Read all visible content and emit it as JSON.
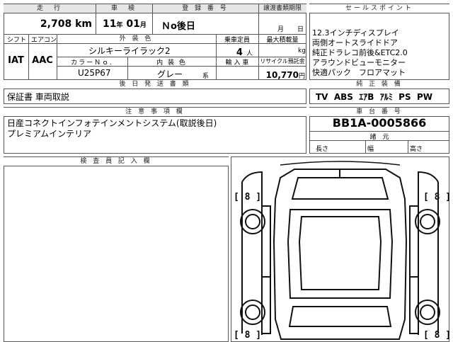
{
  "top_fields": {
    "mileage_header": "走　行",
    "mileage_value": "2,708",
    "mileage_unit": "km",
    "inspection_header": "車　検",
    "inspection_year": "11",
    "inspection_year_unit": "年",
    "inspection_month": "01",
    "inspection_month_unit": "月",
    "registration_header": "登 録 番 号",
    "registration_value": "Ｎo後日",
    "transfer_deadline_header": "譲渡書類期限",
    "transfer_deadline_month": "月",
    "transfer_deadline_day": "日"
  },
  "second_row": {
    "shift_header": "シフト",
    "shift_value": "IAT",
    "aircon_header": "エアコン",
    "aircon_value": "AAC",
    "exterior_color_header": "外 装 色",
    "exterior_color_value": "シルキーライラック2",
    "capacity_header": "乗車定員",
    "capacity_value": "4",
    "capacity_unit": "人",
    "max_load_header": "最大積載量",
    "max_load_unit": "kg",
    "color_no_header": "カラーＮｏ.",
    "color_no_value": "U25P67",
    "interior_color_header": "内 装 色",
    "interior_color_value": "グレー",
    "interior_color_suffix": "系",
    "import_header": "輸 入 車",
    "recycle_header": "リサイクル預託金",
    "recycle_value": "10,770",
    "recycle_unit": "円"
  },
  "later_docs": {
    "header": "後 日 発 送 書 類",
    "value": "保証書 車両取説"
  },
  "sales_points": {
    "header": "セールスポイント",
    "items": [
      "12.3インチディスプレイ",
      "両側オートスライドドア",
      "純正ドラレコ前後&ETC2.0",
      "アラウンドビューモニター",
      "快適パック　フロアマット"
    ]
  },
  "equipment": {
    "header": "純 正 装 備",
    "items": [
      "TV",
      "ABS",
      "ｴｱB",
      "ｱﾙﾐ",
      "PS",
      "PW"
    ]
  },
  "notes": {
    "header": "注 意 事 項 欄",
    "lines": [
      "日産コネクトインフォテインメントシステム(取説後日)",
      "プレミアムインテリア"
    ]
  },
  "chassis": {
    "header": "車 台 番 号",
    "value": "BB1A-0005866"
  },
  "specs": {
    "header": "諸　元",
    "length_label": "長さ",
    "width_label": "幅",
    "height_label": "高さ"
  },
  "inspector": {
    "header": "検 査 員 記 入 欄"
  },
  "tire_scores": {
    "front_left": "8",
    "front_right": "8",
    "rear_left": "8",
    "rear_right": "8"
  }
}
